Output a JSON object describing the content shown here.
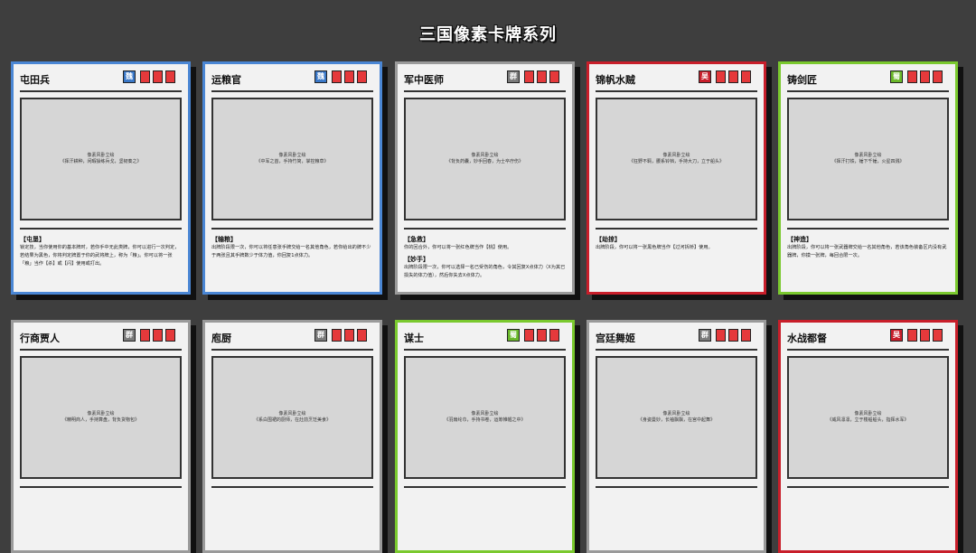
{
  "page": {
    "title": "三国像素卡牌系列"
  },
  "cards": [
    {
      "name": "屯田兵",
      "badge": "魏",
      "color": "blue",
      "art_label": "像素风卧立绘",
      "art_desc": "《挥汗耕种，闲暇操练兵戈，坚韧奏之》",
      "skills": [
        {
          "name": "【屯垦】",
          "text": "锁定技，当你使用你的基本牌时，若你手中无此类牌，你可以进行一次判定，若结果为黑色，你将判定牌置于你的武将牌上，称为「粮」。你可以将一张「粮」当作【杀】或【闪】使用或打出。"
        }
      ]
    },
    {
      "name": "运粮官",
      "badge": "魏",
      "color": "blue",
      "art_label": "像素风卧立绘",
      "art_desc": "《中军之首，手持竹简，掌控粮草》",
      "skills": [
        {
          "name": "【输粮】",
          "text": "出牌阶段限一次，你可以将任意张手牌交给一名其他角色，若你给出的牌不少于两张且其手牌数少于体力值，你回复1点体力。"
        }
      ]
    },
    {
      "name": "军中医师",
      "badge": "群",
      "color": "gray",
      "art_label": "像素风卧立绘",
      "art_desc": "《背负药囊，妙手回春，为士卒疗伤》",
      "skills": [
        {
          "name": "【急救】",
          "text": "你的回合外，你可以将一张红色牌当作【桃】使用。"
        },
        {
          "name": "【妙手】",
          "text": "出牌阶段限一次，你可以选择一名已受伤的角色，令其回复X点体力（X为其已损失的体力值），然后你失去X点体力。"
        }
      ]
    },
    {
      "name": "锦帆水贼",
      "badge": "吴",
      "color": "red",
      "art_label": "像素风卧立绘",
      "art_desc": "《狂野不羁，腰系铃铛，手持大刀，立于船头》",
      "skills": [
        {
          "name": "【劫掠】",
          "text": "出牌阶段，你可以将一张黑色牌当作【过河拆桥】使用。"
        }
      ]
    },
    {
      "name": "铸剑匠",
      "badge": "蜀",
      "color": "green",
      "art_label": "像素风卧立绘",
      "art_desc": "《挥汗打铁，锤下千锤，火星四溅》",
      "skills": [
        {
          "name": "【神造】",
          "text": "出牌阶段，你可以将一张武器牌交给一名其他角色，若该角色装备区内没有武器牌，你摸一张牌，每回合限一次。"
        }
      ]
    },
    {
      "name": "行商贾人",
      "badge": "群",
      "color": "gray",
      "art_label": "像素风卧立绘",
      "art_desc": "《精明商人，手持算盘，背负货物包》",
      "skills": []
    },
    {
      "name": "庖厨",
      "badge": "群",
      "color": "gray",
      "art_label": "像素风卧立绘",
      "art_desc": "《系白围裙的厨师，在灶前烹饪美食》",
      "skills": []
    },
    {
      "name": "谋士",
      "badge": "蜀",
      "color": "green",
      "art_label": "像素风卧立绘",
      "art_desc": "《羽扇纶巾，手持书卷，运筹帷幄之中》",
      "skills": []
    },
    {
      "name": "宫廷舞姬",
      "badge": "群",
      "color": "gray",
      "art_label": "像素风卧立绘",
      "art_desc": "《身姿曼妙，长袖飘飘，在宫中起舞》",
      "skills": []
    },
    {
      "name": "水战都督",
      "badge": "吴",
      "color": "red",
      "art_label": "像素风卧立绘",
      "art_desc": "《威风凛凛，立于楼船船头，指挥水军》",
      "skills": []
    }
  ]
}
